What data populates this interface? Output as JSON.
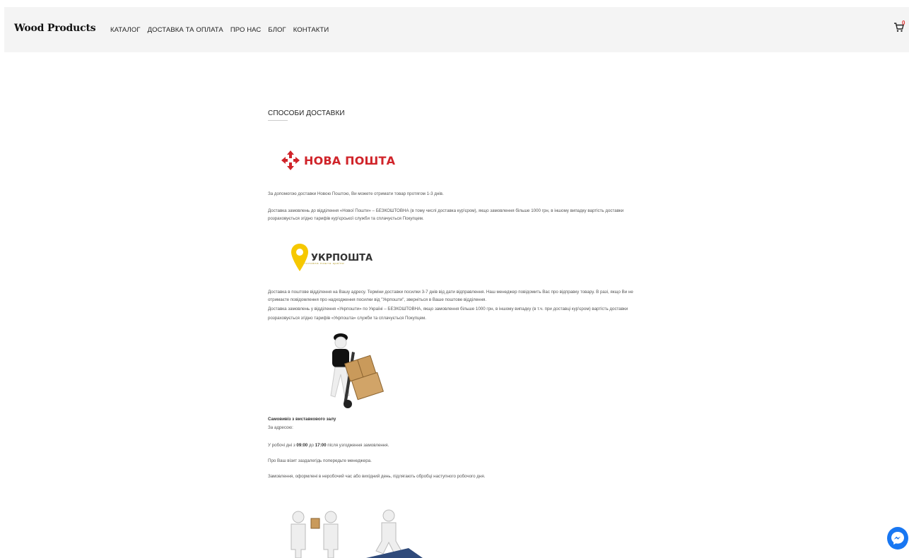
{
  "header": {
    "brand": "Wood Products",
    "nav": [
      "КАТАЛОГ",
      "ДОСТАВКА ТА ОПЛАТА",
      "ПРО НАС",
      "БЛОГ",
      "КОНТАКТИ"
    ],
    "cart_count": "0"
  },
  "main": {
    "section_title": "СПОСОБИ ДОСТАВКИ",
    "nova_poshta": {
      "logo_text": "НОВА ПОШТА",
      "p1": "За допомогою доставки Новою Поштою, Ви можете отримати товар протягом 1-3 днів.",
      "p2a": "Доставка замовлень до відділення «Нової Пошти» – БЕЗКОШТОВНА (в тому числі доставка кур'єром), якщо замовлення більше 1000 грн, в іншому випадку вартість доставки",
      "p2b": "розраховується згідно тарифів кур'єрської служби та сплачується Покупцем."
    },
    "ukrposhta": {
      "logo_text": "УКРПОШТА",
      "logo_sub": "головна пошта країни",
      "p1a": "Доставка в поштове відділення на Вашу адресу. Терміни доставки посилки 3-7 днів від дати відправлення. Наш менеджер повідомить Вас про відправку товару. В разі, якщо Ви не",
      "p1b": "отримаєте повідомлення про надходження посилки від \"Укрпошти\", зверніться в Ваше поштове відділення.",
      "p2a": "Доставка замовлень у відділення «Укрпошти» по Україні – БЕЗКОШТОВНА, якщо замовлення більше 1000 грн, в іншому випадку (в т.ч. при доставці кур'єром) вартість доставки",
      "p2b": "розраховується згідно тарифів «Укрпошта» служби та сплачується Покупцем."
    },
    "pickup": {
      "title": "Самовивіз з виставкового залу",
      "address_label": "За адресою:",
      "hours_prefix": "У робочі дні з ",
      "hours_from": "09:00",
      "hours_mid": " до ",
      "hours_to": "17:00",
      "hours_suffix": " після узгодження замовлення.",
      "notice": "Про Ваш візит заздалегідь попередьте менеджера.",
      "weekend": "Замовлення, оформлені в неробочий час або вихідний день, підлягають обробці наступного робочого дня."
    }
  },
  "colors": {
    "nova_poshta_red": "#d0242a",
    "ukrposhta_yellow": "#f6c800",
    "messenger_blue": "#1877f2",
    "header_bg": "#f4f4f4"
  },
  "icons": {
    "cart": "cart-icon",
    "messenger": "messenger-icon"
  }
}
